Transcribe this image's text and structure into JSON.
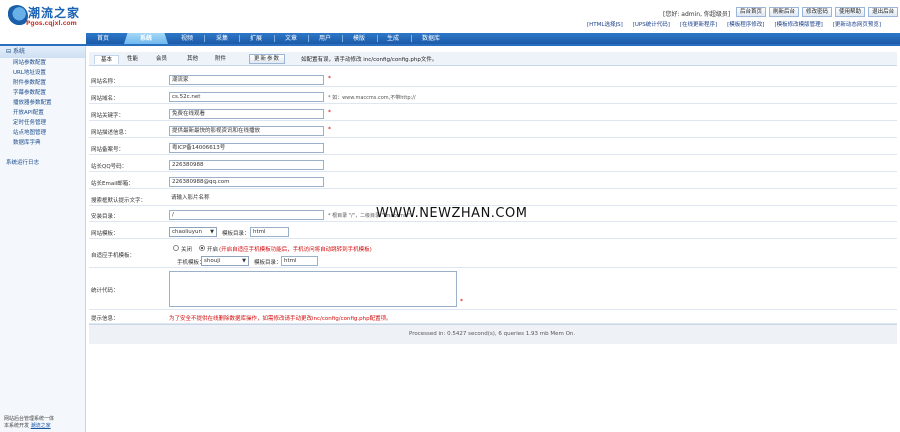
{
  "header": {
    "logo_title": "潮流之家",
    "logo_sub": "Pgos.cqjxl.com",
    "user_label": "[您好: admin, 你超级员]",
    "top_buttons": [
      "后台首页",
      "刷新后台",
      "修改密码",
      "使用帮助",
      "退出后台"
    ],
    "top_links": [
      "[HTML选择JS]",
      "[UPS统计代码]",
      "[在线更新程序]",
      "[模板程序修改]",
      "[模板修改模版管理]",
      "[更新动态网页预览]"
    ]
  },
  "nav": {
    "items": [
      "首页",
      "系统",
      "视频",
      "采集",
      "扩展",
      "文章",
      "用户",
      "模版",
      "生成",
      "数据库"
    ],
    "active_index": 1
  },
  "sidebar": {
    "section_title": "系统",
    "items": [
      "网站参数配置",
      "URL地址设置",
      "附件参数配置",
      "字幕参数配置",
      "播放器参数配置",
      "开放API配置",
      "定时任务管理",
      "站点地图管理",
      "数据库字典"
    ],
    "extra_item": "系统运行日志",
    "footer_line1": "网站后台管理系统一体",
    "footer_line2": "本系统开发",
    "footer_link": "潮流之家"
  },
  "subtabs": {
    "items": [
      "基本",
      "性能",
      "会员",
      "其他",
      "附件"
    ],
    "active_index": 0,
    "refresh_label": "更新参数",
    "note": "如配置有误，请手动修改 inc/config/config.php文件。"
  },
  "form": {
    "site_name": {
      "label": "网站名称：",
      "value": "潮流家"
    },
    "site_url": {
      "label": "网站域名：",
      "value": "cs.52c.net",
      "hint": "* 如：www.maccms.com,不带http://"
    },
    "keywords": {
      "label": "网站关键字：",
      "value": "免费在线观看"
    },
    "description": {
      "label": "网站描述信息：",
      "value": "提供最新最快的影视资讯和在线播放"
    },
    "icp": {
      "label": "网站备案号：",
      "value": "粤ICP备14006613号"
    },
    "qq": {
      "label": "站长QQ号码：",
      "value": "226380988"
    },
    "email": {
      "label": "站长Email邮箱：",
      "value": "226380988@qq.com"
    },
    "search_hint": {
      "label": "搜索框默认提示文字：",
      "value": "请输入影片名称"
    },
    "install_dir": {
      "label": "安装目录：",
      "value": "/",
      "hint": "* 根目录 \"/\"，二级目录 \"/maccms/\""
    },
    "template": {
      "label": "网站模板：",
      "value": "chaoliuyun",
      "dir_label": "模板目录：",
      "dir_value": "html"
    },
    "mobile": {
      "label": "自适应手机模板：",
      "option_off": "关闭",
      "option_on": "开启",
      "selected": "开启",
      "note": "(开启自适应手机模板功能后，手机访问将自动跳转到手机模板)",
      "template_label": "手机模板：",
      "template_value": "shouji",
      "dir_label": "模板目录：",
      "dir_value": "html"
    },
    "stats": {
      "label": "统计代码：",
      "value": ""
    },
    "tip": {
      "label": "提示信息：",
      "text": "为了安全不提供在线删除数据库操作，如需修改请手动更改inc/config/config.php配置项。"
    }
  },
  "footer": {
    "text": "Processed in: 0.5427 second(s), 6 queries 1.93 mb Mem On."
  },
  "watermark": "WWW.NEWZHAN.COM"
}
